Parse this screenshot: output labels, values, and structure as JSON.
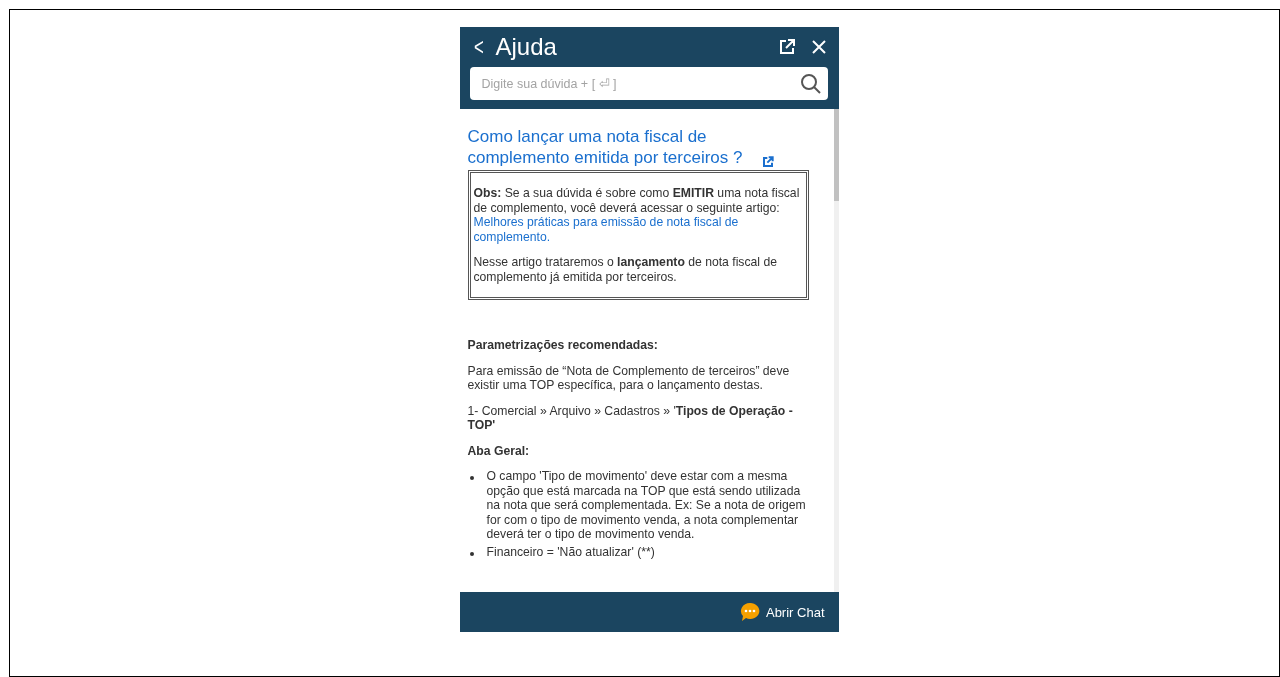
{
  "header": {
    "back": "<",
    "title": "Ajuda"
  },
  "search": {
    "placeholder": "Digite sua dúvida + [ ⏎ ]"
  },
  "article": {
    "title": "Como lançar uma nota fiscal de complemento emitida por terceiros ?",
    "note": {
      "text": "**Obs:** Se a sua dúvida é sobre como **EMITIR** uma nota fiscal de complemento, você deverá acessar o seguinte artigo:",
      "link": "Melhores práticas para emissão de nota fiscal de complemento.",
      "text2": "Nesse artigo trataremos o **lançamento** de nota fiscal de complemento já emitida por terceiros."
    },
    "blocks": [
      {
        "kind": "heading",
        "text": "Parametrizações recomendadas:"
      },
      {
        "kind": "paragraph",
        "text": "Para emissão de “Nota de Complemento de terceiros” deve existir uma TOP específica, para o lançamento destas."
      },
      {
        "kind": "paragraph",
        "text": "1- Comercial » Arquivo » Cadastros » '**Tipos de Operação - TOP'**"
      },
      {
        "kind": "heading",
        "text": "Aba Geral:"
      },
      {
        "kind": "bullets",
        "items": [
          "O campo 'Tipo de movimento' deve estar com a mesma opção que está marcada na TOP que está sendo utilizada na nota que será complementada. Ex: Se a nota de origem for com o tipo de movimento venda, a nota complementar deverá ter o tipo de movimento venda.",
          "Financeiro = 'Não atualizar' (**)"
        ]
      }
    ]
  },
  "footer": {
    "chat": "Abrir Chat"
  }
}
